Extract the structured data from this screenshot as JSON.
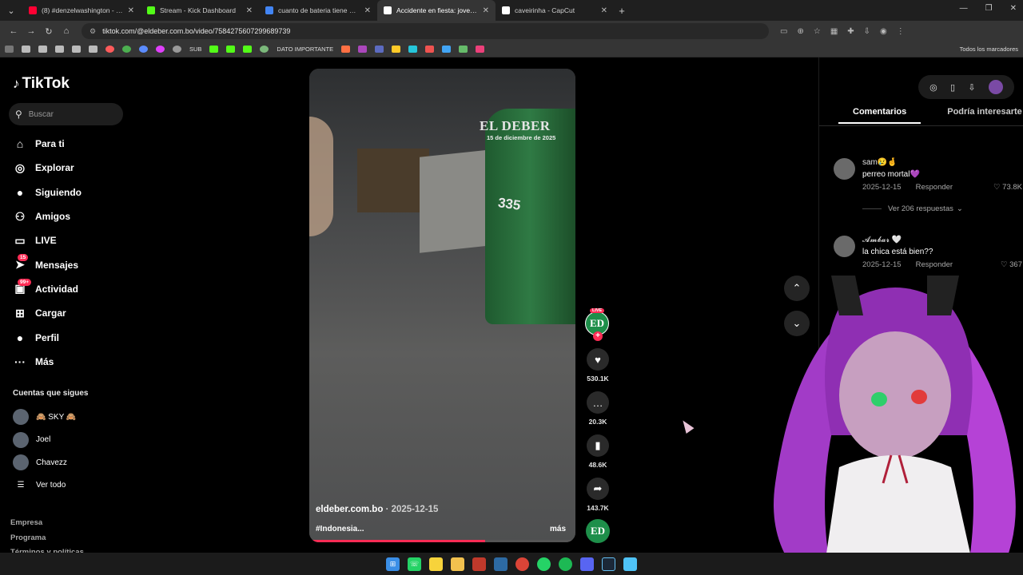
{
  "browser": {
    "tabs": [
      {
        "title": "(8) #denzelwashington - YouTube",
        "active": false,
        "favicon_color": "#ff0033"
      },
      {
        "title": "Stream - Kick Dashboard",
        "active": false,
        "favicon_color": "#53fc18"
      },
      {
        "title": "cuanto de bateria tiene el sams",
        "active": false,
        "favicon_color": "#4285f4"
      },
      {
        "title": "Accidente en fiesta: joven c",
        "active": true,
        "favicon_color": "#ffffff"
      },
      {
        "title": "caveirinha - CapCut",
        "active": false,
        "favicon_color": "#ffffff"
      }
    ],
    "url": "tiktok.com/@eldeber.com.bo/video/7584275607299689739",
    "bookmarks": [
      "SUB",
      "DATO IMPORTANTE"
    ],
    "bookmarks_right": "Todos los marcadores"
  },
  "tiktok": {
    "logo": "TikTok",
    "search_placeholder": "Buscar",
    "nav": [
      {
        "label": "Para ti",
        "icon": "home-icon",
        "glyph": "⌂"
      },
      {
        "label": "Explorar",
        "icon": "compass-icon",
        "glyph": "◎"
      },
      {
        "label": "Siguiendo",
        "icon": "following-avatar-icon",
        "glyph": "●"
      },
      {
        "label": "Amigos",
        "icon": "friends-icon",
        "glyph": "⚇"
      },
      {
        "label": "LIVE",
        "icon": "live-icon",
        "glyph": "▭"
      },
      {
        "label": "Mensajes",
        "icon": "messages-icon",
        "glyph": "➤",
        "badge": "15"
      },
      {
        "label": "Actividad",
        "icon": "activity-icon",
        "glyph": "▣",
        "badge": "99+"
      },
      {
        "label": "Cargar",
        "icon": "upload-icon",
        "glyph": "⊞"
      },
      {
        "label": "Perfil",
        "icon": "profile-avatar-icon",
        "glyph": "●"
      },
      {
        "label": "Más",
        "icon": "more-icon",
        "glyph": "···"
      }
    ],
    "following_title": "Cuentas que sigues",
    "following": [
      {
        "name": "🙈 SKY 🙈"
      },
      {
        "name": "Joel"
      },
      {
        "name": "Chavezz"
      },
      {
        "name": "Ver todo"
      }
    ],
    "footer_links": [
      "Empresa",
      "Programa",
      "Términos y políticas"
    ]
  },
  "video": {
    "watermark": "EL DEBER",
    "watermark_date": "15 de diciembre de 2025",
    "truck_number": "335",
    "author": "eldeber.com.bo",
    "date": "· 2025-12-15",
    "caption": "#Indonesia...",
    "more": "más",
    "progress": 0.66
  },
  "actions": {
    "creator_initials": "ED",
    "live_label": "LIVE",
    "likes": "530.1K",
    "comments": "20.3K",
    "saves": "48.6K",
    "shares": "143.7K"
  },
  "comments_panel": {
    "tabs": [
      "Comentarios",
      "Podría interesarte"
    ],
    "comments": [
      {
        "user": "sam😢🤞",
        "text": "perreo mortal💜",
        "date": "2025-12-15",
        "reply": "Responder",
        "likes": "73.8K"
      },
      {
        "user": "𝓐𝓶𝓫𝓪𝓻 🤍",
        "text": "la chica está bien??",
        "date": "2025-12-15",
        "reply": "Responder",
        "likes": "367"
      }
    ],
    "view_replies": "Ver 206 respuestas"
  },
  "colors": {
    "accent": "#fe2c55",
    "creator_green": "#1e8f4a"
  }
}
